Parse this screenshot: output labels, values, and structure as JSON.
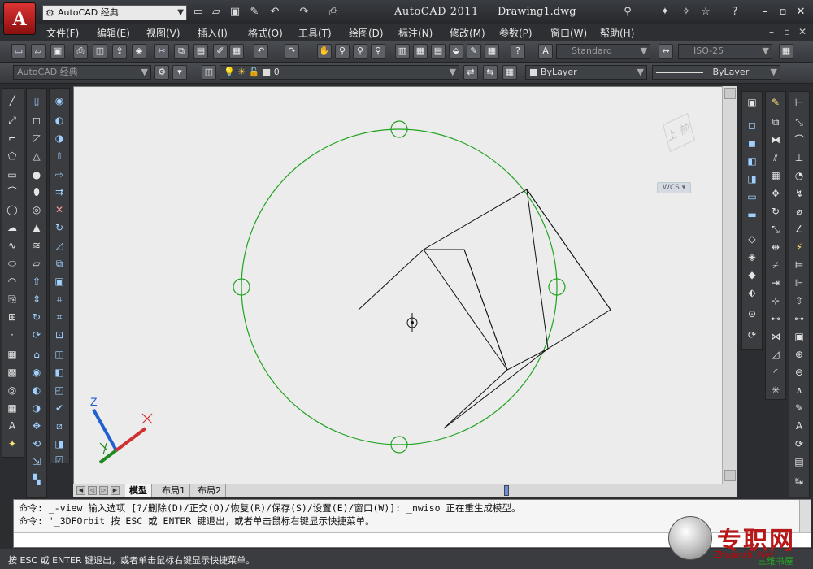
{
  "titlebar": {
    "app_title": "AutoCAD 2011",
    "doc_title": "Drawing1.dwg",
    "workspace": "AutoCAD 经典",
    "app_button_letter": "A"
  },
  "menu": {
    "items": [
      "文件(F)",
      "编辑(E)",
      "视图(V)",
      "插入(I)",
      "格式(O)",
      "工具(T)",
      "绘图(D)",
      "标注(N)",
      "修改(M)",
      "参数(P)",
      "窗口(W)",
      "帮助(H)"
    ]
  },
  "toolbar": {
    "text_style": "Standard",
    "dim_style": "ISO-25",
    "workspace2": "AutoCAD 经典",
    "layer": "0",
    "color": "ByLayer",
    "linetype": "ByLayer"
  },
  "tabs": [
    "模型",
    "布局1",
    "布局2"
  ],
  "viewcube": {
    "text": "上 前",
    "wcs": "WCS"
  },
  "command": {
    "line1": "命令: _-view 输入选项 [?/删除(D)/正交(O)/恢复(R)/保存(S)/设置(E)/窗口(W)]: _nwiso 正在重生成模型。",
    "line2": "命令: '_3DFOrbit 按 ESC 或 ENTER 键退出，或者单击鼠标右键显示快捷菜单。"
  },
  "status": "按 ESC 或 ENTER 键退出，或者单击鼠标右键显示快捷菜单。",
  "watermark": {
    "cn": "专职网",
    "en": "Zhuanzhi.Net",
    "sub": "三维书屋"
  },
  "ucs": {
    "z_label": "Z"
  },
  "colors": {
    "orbit": "#1fa31f",
    "x_axis": "#d03030",
    "y_axis": "#1f8a1f",
    "z_axis": "#2060d0"
  }
}
